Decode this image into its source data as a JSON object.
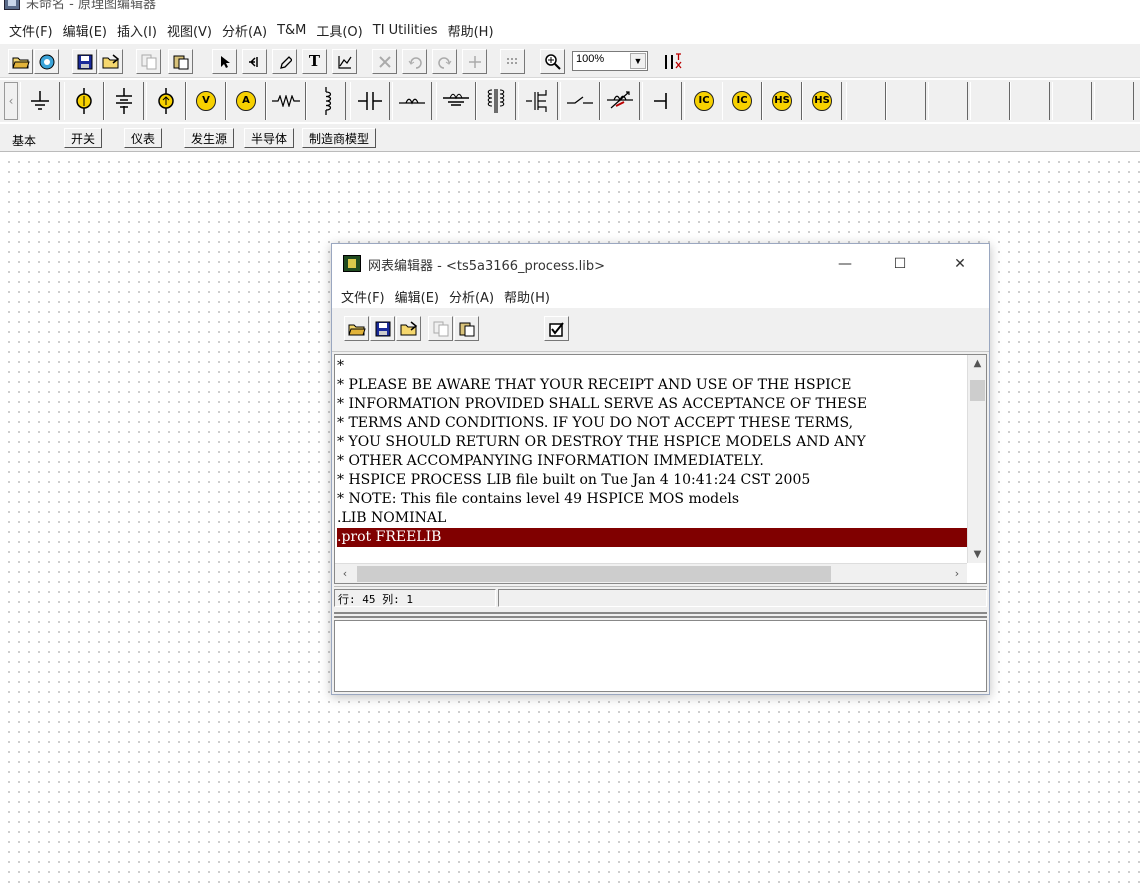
{
  "app": {
    "title": "未命名 - 原理图编辑器",
    "menu": [
      "文件(F)",
      "编辑(E)",
      "插入(I)",
      "视图(V)",
      "分析(A)",
      "T&M",
      "工具(O)",
      "TI Utilities",
      "帮助(H)"
    ],
    "toolbar": {
      "zoom": "100%",
      "buttons": [
        "open-folder-icon",
        "search-icon",
        "save-icon",
        "open-file-icon",
        "copy-icon",
        "paste-icon",
        "pointer-icon",
        "wire-icon",
        "pencil-icon",
        "text-icon",
        "graph-icon",
        "delete-icon",
        "undo-icon",
        "redo-icon",
        "cross-icon",
        "grid-icon",
        "zoom-icon",
        "dropdown-icon",
        "tk-icon"
      ],
      "text_button": "T"
    },
    "components": {
      "meter_labels": {
        "voltmeter": "V",
        "ammeter": "A",
        "ic": "IC",
        "ic_plus": "IC",
        "hs": "HS",
        "hs_plus": "HS"
      },
      "icons": [
        "ground-icon",
        "voltage-source-icon",
        "battery-icon",
        "current-source-icon",
        "voltmeter-icon",
        "ammeter-icon",
        "resistor-icon",
        "inductor-icon",
        "capacitor-icon",
        "wire-ground-icon",
        "switch-icon",
        "transformer-icon",
        "mosfet-icon",
        "diode-icon",
        "potentiometer-icon",
        "opamp-icon",
        "ic-icon",
        "ic-plus-icon",
        "hs-icon",
        "hs-plus-icon"
      ]
    },
    "tabs": [
      "基本",
      "开关",
      "仪表",
      "发生源",
      "半导体",
      "制造商模型"
    ],
    "colors": {
      "selection": "#800000",
      "meter": "#f7d100"
    }
  },
  "netlist_window": {
    "title": "网表编辑器 - <ts5a3166_process.lib>",
    "controls": {
      "minimize": "—",
      "maximize": "☐",
      "close": "✕"
    },
    "menu": [
      "文件(F)",
      "编辑(E)",
      "分析(A)",
      "帮助(H)"
    ],
    "toolbar": [
      "open-folder-icon",
      "save-icon",
      "open-file-icon",
      "copy-icon",
      "paste-icon",
      "check-icon"
    ],
    "lines": [
      "*",
      "* PLEASE BE AWARE THAT YOUR RECEIPT AND USE OF THE HSPICE",
      "* INFORMATION PROVIDED SHALL SERVE AS ACCEPTANCE OF THESE",
      "* TERMS AND CONDITIONS. IF YOU DO NOT ACCEPT THESE TERMS,",
      "* YOU SHOULD RETURN OR DESTROY THE HSPICE MODELS AND ANY",
      "* OTHER ACCOMPANYING INFORMATION IMMEDIATELY.",
      "* HSPICE PROCESS LIB file built on Tue Jan 4 10:41:24 CST 2005",
      "* NOTE: This file contains level 49 HSPICE MOS models",
      ".LIB NOMINAL",
      ".prot FREELIB"
    ],
    "selected_line": 9,
    "status": {
      "position": "行: 45 列: 1",
      "extra": ""
    }
  }
}
